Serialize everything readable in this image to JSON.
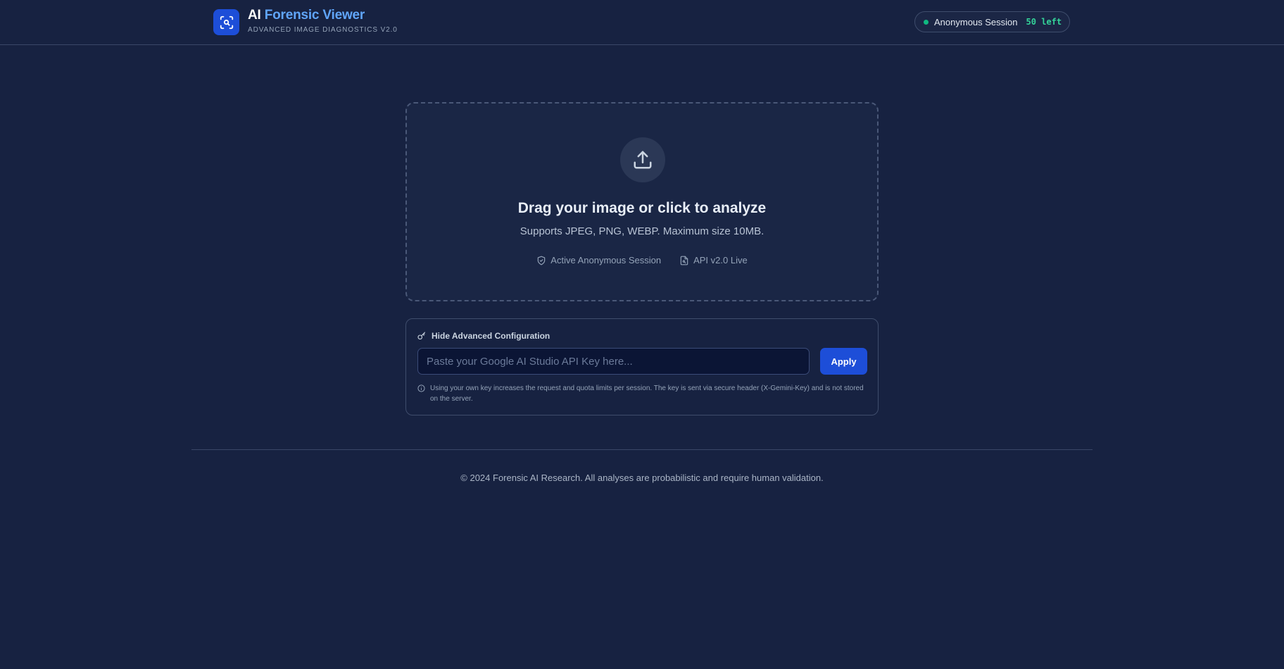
{
  "header": {
    "brand_prefix": "AI",
    "brand_name": "Forensic Viewer",
    "subtitle": "ADVANCED IMAGE DIAGNOSTICS V2.0",
    "logo_icon": "scan-search-icon",
    "session": {
      "label": "Anonymous Session",
      "remaining": "50 left",
      "status_color": "#10b981"
    }
  },
  "upload": {
    "icon": "upload-icon",
    "title": "Drag your image or click to analyze",
    "subtitle": "Supports JPEG, PNG, WEBP. Maximum size 10MB.",
    "meta": [
      {
        "icon": "shield-check-icon",
        "label": "Active Anonymous Session"
      },
      {
        "icon": "file-icon",
        "label": "API v2.0 Live"
      }
    ]
  },
  "config": {
    "toggle_label": "Hide Advanced Configuration",
    "toggle_icon": "key-icon",
    "api_key": {
      "value": "",
      "placeholder": "Paste your Google AI Studio API Key here..."
    },
    "apply_label": "Apply",
    "note": "Using your own key increases the request and quota limits per session. The key is sent via secure header (X-Gemini-Key) and is not stored on the server."
  },
  "footer": {
    "text": "© 2024 Forensic AI Research. All analyses are probabilistic and require human validation."
  },
  "colors": {
    "background": "#172241",
    "accent": "#1d4ed8",
    "brand_highlight": "#60a5fa",
    "success": "#34d399"
  }
}
